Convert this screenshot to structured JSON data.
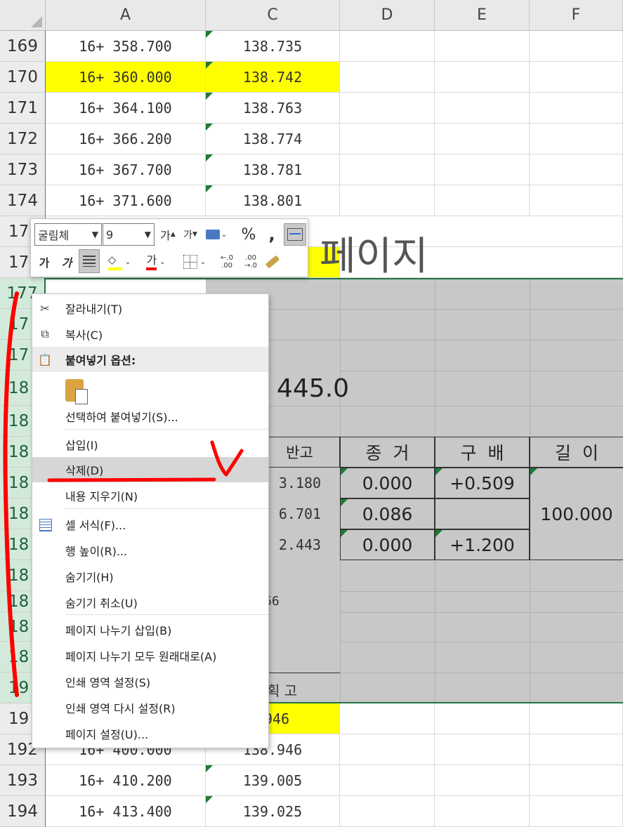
{
  "columns": [
    {
      "label": "A"
    },
    {
      "label": "C"
    },
    {
      "label": "D"
    },
    {
      "label": "E"
    },
    {
      "label": "F"
    }
  ],
  "rows_top": [
    {
      "num": "169",
      "a": "16+ 358.700",
      "c": "138.735"
    },
    {
      "num": "170",
      "a": "16+ 360.000",
      "c": "138.742"
    },
    {
      "num": "171",
      "a": "16+ 364.100",
      "c": "138.763"
    },
    {
      "num": "172",
      "a": "16+ 366.200",
      "c": "138.774"
    },
    {
      "num": "173",
      "a": "16+ 367.700",
      "c": "138.781"
    },
    {
      "num": "174",
      "a": "16+ 371.600",
      "c": "138.801"
    },
    {
      "num": "17"
    },
    {
      "num": "17"
    }
  ],
  "rows_selected": [
    "177",
    "17",
    "17",
    "18",
    "18",
    "18",
    "18",
    "18",
    "18",
    "18",
    "18",
    "18",
    "18",
    "19"
  ],
  "rows_bottom": [
    {
      "num": "19",
      "c": ".946"
    },
    {
      "num": "192",
      "a": "16+ 400.000",
      "c": "138.946"
    },
    {
      "num": "193",
      "a": "16+ 410.200",
      "c": "139.005"
    },
    {
      "num": "194",
      "a": "16+ 413.400",
      "c": "139.025"
    }
  ],
  "page_text": "페이지",
  "big_number": "445.0",
  "table": {
    "headers": [
      "반고",
      "종  거",
      "구  배",
      "길  이"
    ],
    "col_c": [
      "3.180",
      "6.701",
      "2.443"
    ],
    "col_d": [
      "0.000",
      "0.086",
      "0.000"
    ],
    "col_e": [
      "+0.509",
      "",
      "+1.200"
    ],
    "col_f": "100.000",
    "c_row_186": "66",
    "c_row_190": "획 고"
  },
  "mini_toolbar": {
    "font_name": "굴림체",
    "font_size": "9",
    "grow_font": "가",
    "shrink_font": "가",
    "percent": "%",
    "comma": ",",
    "bold": "가",
    "italic": "가",
    "font_color": "가",
    "inc_decimal": "←.0\n.00",
    "dec_decimal": ".00\n→.0"
  },
  "context_menu": {
    "items": [
      {
        "label": "잘라내기(T)",
        "icon": "scissors-icon"
      },
      {
        "label": "복사(C)",
        "icon": "copy-icon"
      },
      {
        "label": "붙여넣기 옵션:",
        "icon": "paste-icon",
        "header": true
      },
      {
        "label": "",
        "icon": "paste-clipboard-icon",
        "paste_option": true
      },
      {
        "label": "선택하여 붙여넣기(S)..."
      },
      {
        "label": "삽입(I)"
      },
      {
        "label": "삭제(D)",
        "highlighted": true
      },
      {
        "label": "내용 지우기(N)"
      },
      {
        "label": "셀 서식(F)...",
        "icon": "format-cells-icon"
      },
      {
        "label": "행 높이(R)..."
      },
      {
        "label": "숨기기(H)"
      },
      {
        "label": "숨기기 취소(U)"
      },
      {
        "label": "페이지 나누기 삽입(B)"
      },
      {
        "label": "페이지 나누기 모두 원래대로(A)"
      },
      {
        "label": "인쇄 영역 설정(S)"
      },
      {
        "label": "인쇄 영역 다시 설정(R)"
      },
      {
        "label": "페이지 설정(U)..."
      }
    ]
  },
  "colors": {
    "accent_green": "#217346",
    "highlight": "#ffff00",
    "selection_gray": "#c8c8c8",
    "annotation_red": "#ff0000"
  }
}
